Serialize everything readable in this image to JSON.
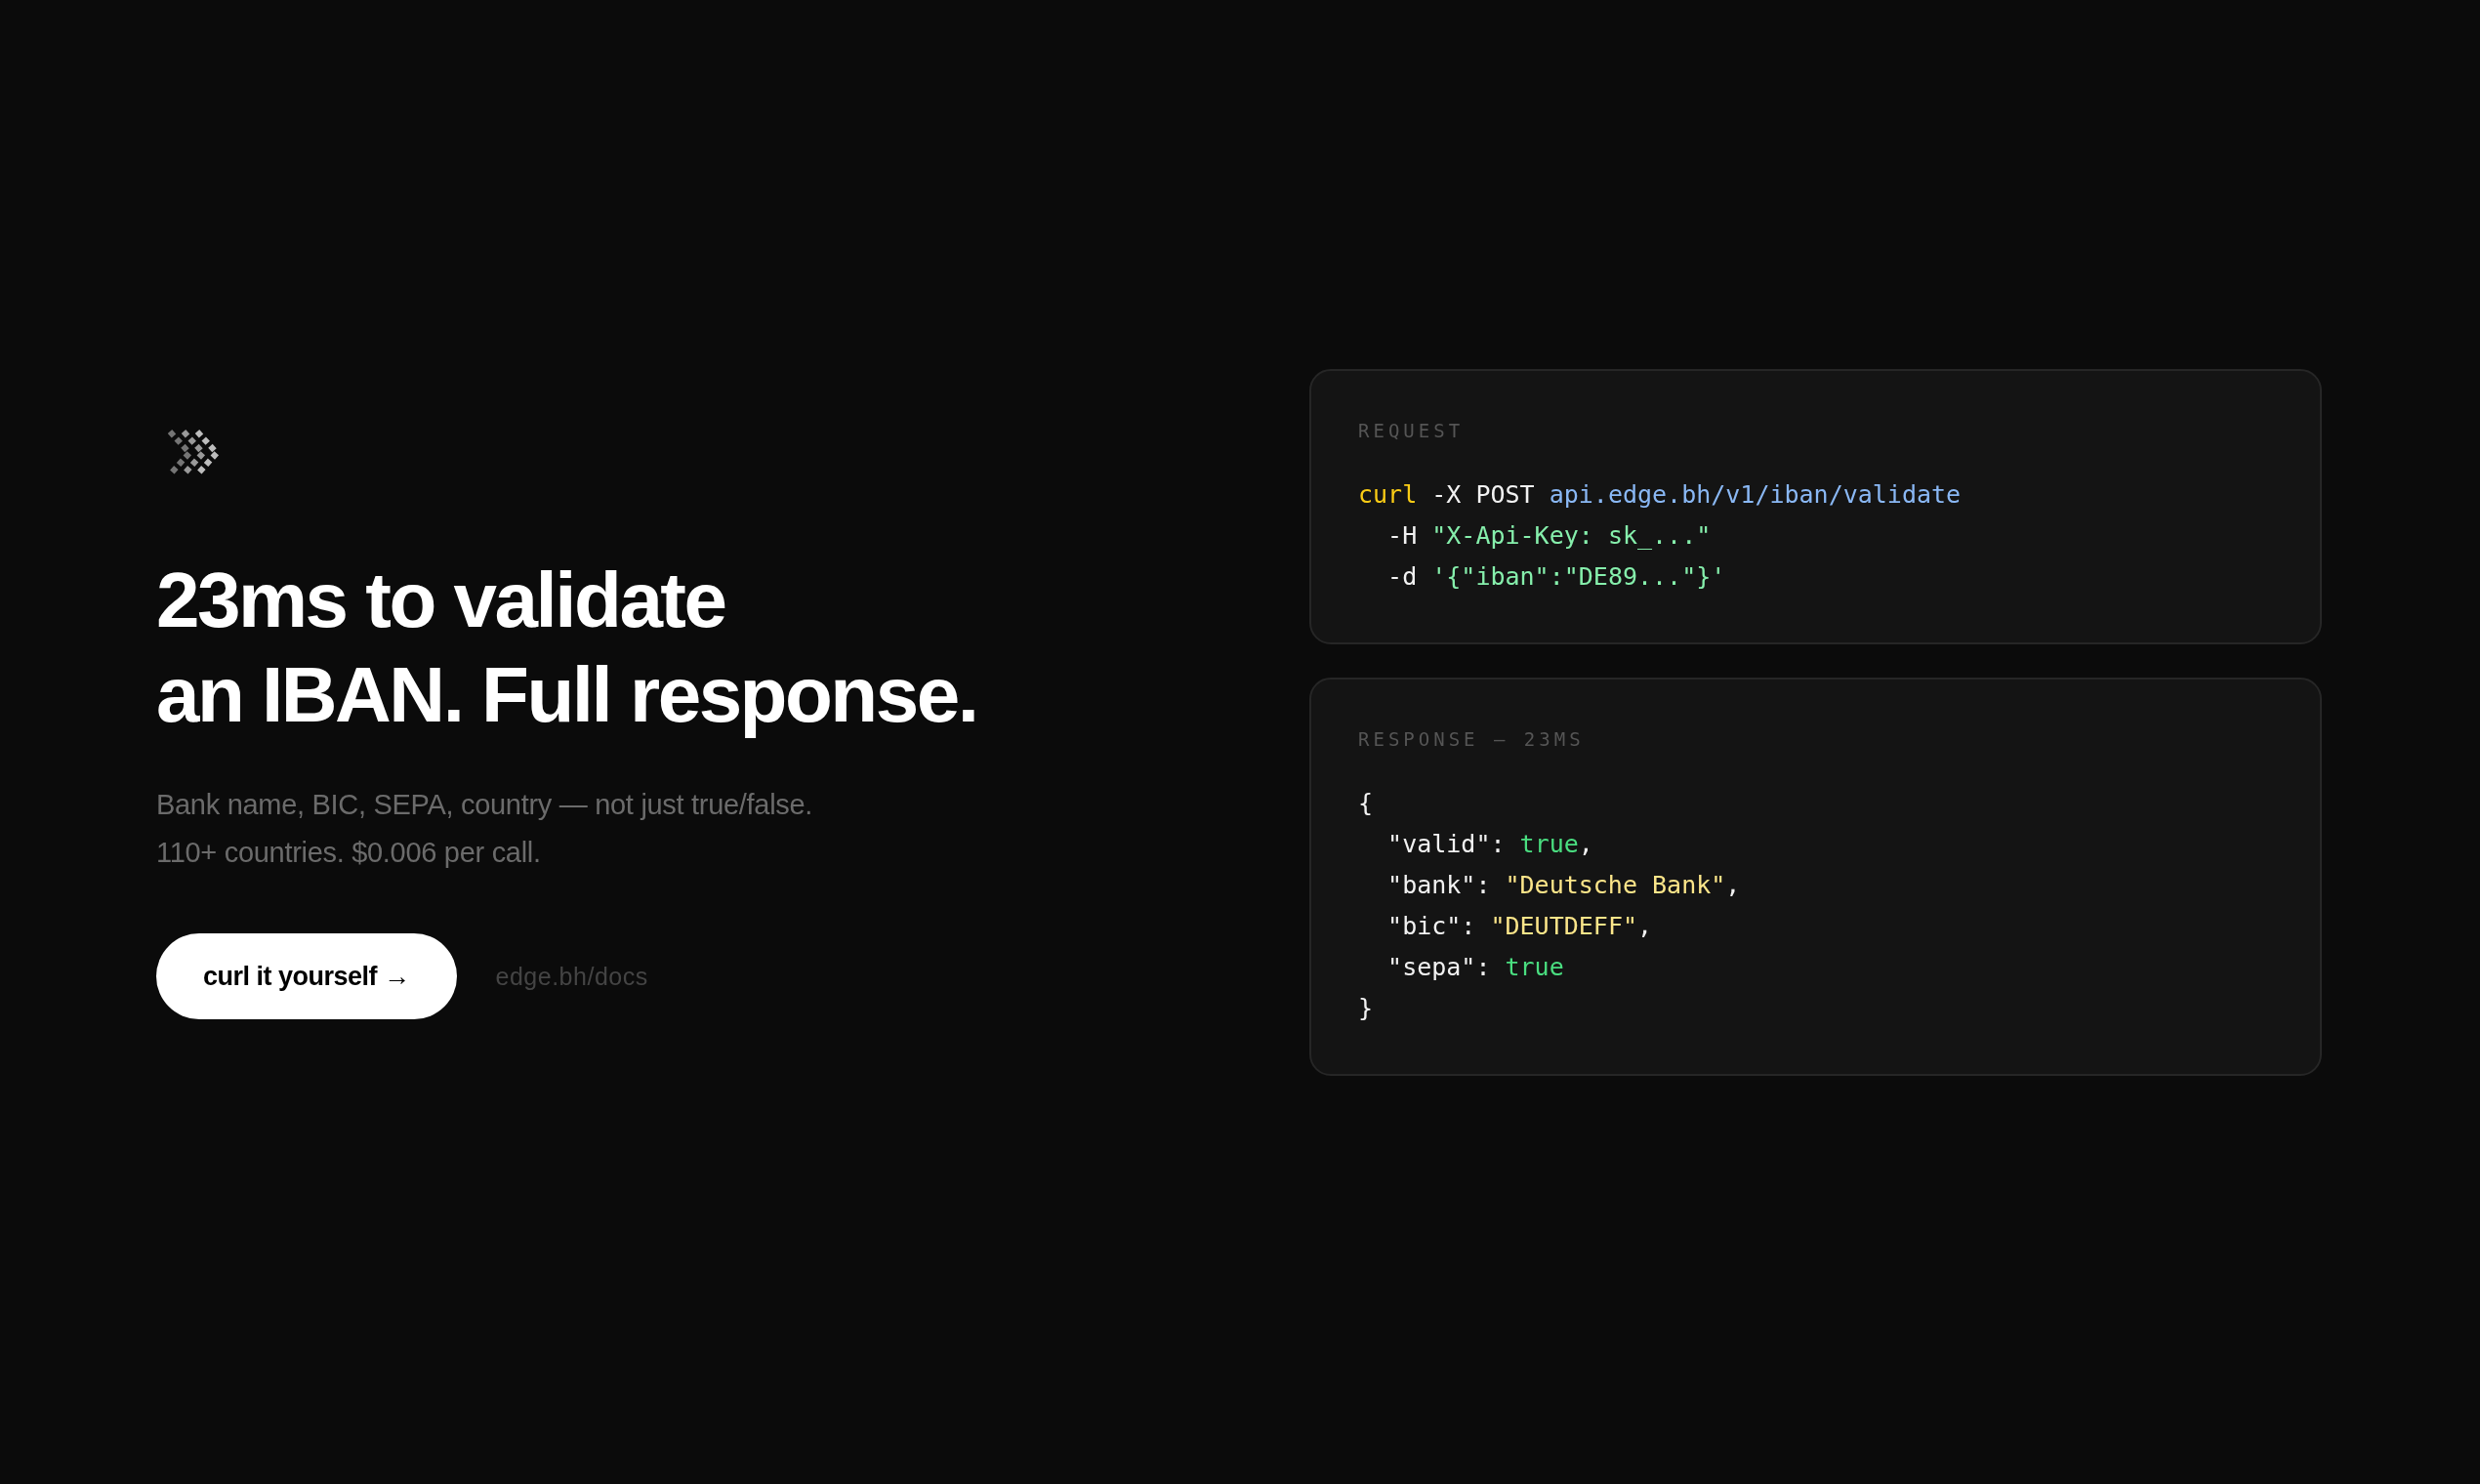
{
  "hero": {
    "headline": [
      "23ms to validate",
      "an IBAN. Full response."
    ],
    "subtitle": [
      "Bank name, BIC, SEPA, country — not just true/false.",
      "110+ countries. $0.006 per call."
    ],
    "cta_button": "curl it yourself →",
    "docs_link": "edge.bh/docs"
  },
  "cards": [
    {
      "label": "REQUEST",
      "lines": [
        [
          {
            "kind": "command",
            "text": "curl"
          },
          {
            "kind": "plain",
            "text": " -X POST "
          },
          {
            "kind": "url",
            "text": "api.edge.bh/v1/iban/validate"
          }
        ],
        [
          {
            "kind": "plain",
            "text": "  -H "
          },
          {
            "kind": "argument",
            "text": "\"X-Api-Key: sk_...\""
          }
        ],
        [
          {
            "kind": "plain",
            "text": "  -d "
          },
          {
            "kind": "argument",
            "text": "'{\"iban\":\"DE89...\"}'"
          }
        ]
      ]
    },
    {
      "label": "RESPONSE — 23MS",
      "lines": [
        [
          {
            "kind": "plain",
            "text": "{"
          }
        ],
        [
          {
            "kind": "plain",
            "text": "  \"valid\": "
          },
          {
            "kind": "boolean",
            "text": "true"
          },
          {
            "kind": "plain",
            "text": ","
          }
        ],
        [
          {
            "kind": "plain",
            "text": "  \"bank\": "
          },
          {
            "kind": "text_value",
            "text": "\"Deutsche Bank\""
          },
          {
            "kind": "plain",
            "text": ","
          }
        ],
        [
          {
            "kind": "plain",
            "text": "  \"bic\": "
          },
          {
            "kind": "text_value",
            "text": "\"DEUTDEFF\""
          },
          {
            "kind": "plain",
            "text": ","
          }
        ],
        [
          {
            "kind": "plain",
            "text": "  \"sepa\": "
          },
          {
            "kind": "boolean",
            "text": "true"
          }
        ],
        [
          {
            "kind": "plain",
            "text": "}"
          }
        ]
      ]
    }
  ]
}
